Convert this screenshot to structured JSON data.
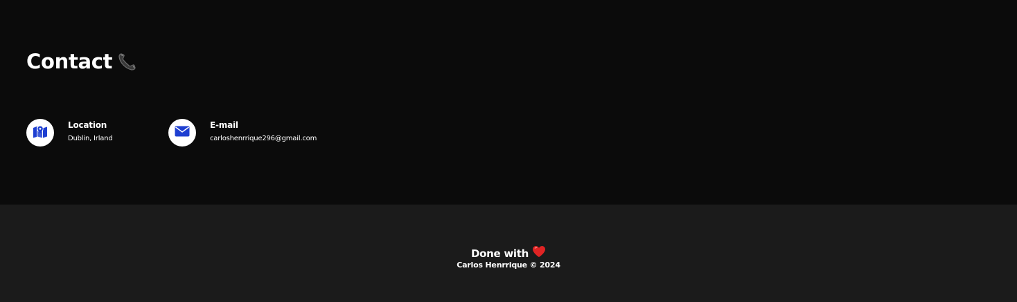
{
  "contact": {
    "title": "Contact",
    "title_icon": "telephone-receiver-icon",
    "items": [
      {
        "icon": "map-location-icon",
        "label": "Location",
        "value": "Dublin, Irland"
      },
      {
        "icon": "envelope-icon",
        "label": "E-mail",
        "value": "carloshenrrique296@gmail.com"
      }
    ]
  },
  "footer": {
    "made_with": "Done with",
    "made_with_icon": "red-heart-icon",
    "credit": "Carlos Henrrique © 2024"
  },
  "colors": {
    "background": "#0b0b0b",
    "footer_background": "#1b1b1b",
    "icon_blue": "#1e3fd1",
    "text": "#ffffff",
    "heart": "#e02424"
  }
}
